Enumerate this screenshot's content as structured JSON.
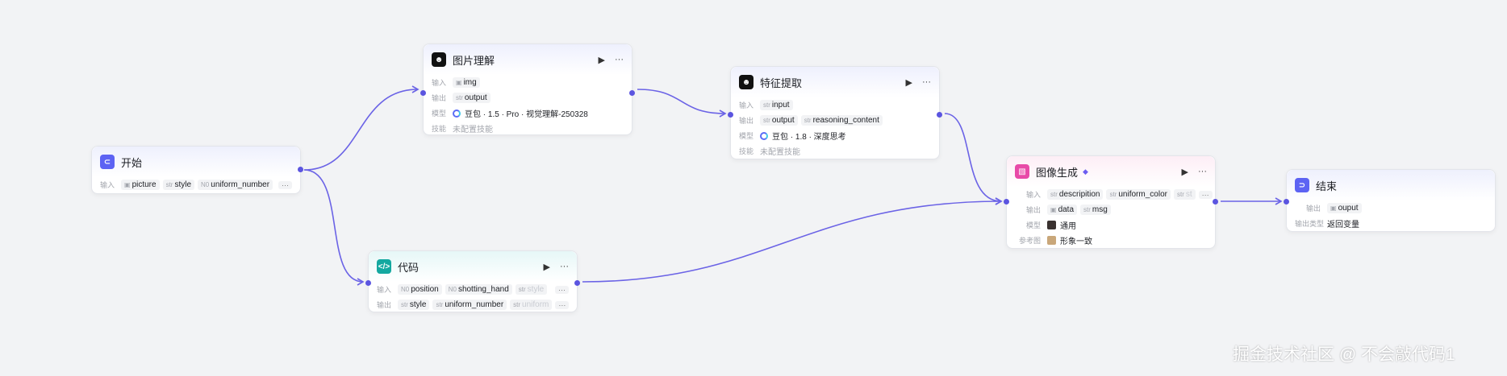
{
  "colors": {
    "edge": "#6b63e6",
    "accent": "#5b55e0"
  },
  "start": {
    "title": "开始",
    "input_label": "输入",
    "inputs": [
      {
        "type": "img",
        "name": "picture"
      },
      {
        "type": "str",
        "name": "style"
      },
      {
        "type": "N0",
        "name": "uniform_number"
      }
    ],
    "more": "···"
  },
  "image_understand": {
    "title": "图片理解",
    "input_label": "输入",
    "inputs": [
      {
        "type": "img",
        "name": "img"
      }
    ],
    "output_label": "输出",
    "outputs": [
      {
        "type": "str",
        "name": "output"
      }
    ],
    "model_label": "模型",
    "model": "豆包 · 1.5 · Pro · 视觉理解-250328",
    "skill_label": "技能",
    "skill": "未配置技能"
  },
  "feature_extract": {
    "title": "特征提取",
    "input_label": "输入",
    "inputs": [
      {
        "type": "str",
        "name": "input"
      }
    ],
    "output_label": "输出",
    "outputs": [
      {
        "type": "str",
        "name": "output"
      },
      {
        "type": "str",
        "name": "reasoning_content"
      }
    ],
    "model_label": "模型",
    "model": "豆包 · 1.8 · 深度思考",
    "skill_label": "技能",
    "skill": "未配置技能"
  },
  "code": {
    "title": "代码",
    "input_label": "输入",
    "inputs": [
      {
        "type": "N0",
        "name": "position"
      },
      {
        "type": "N0",
        "name": "shotting_hand"
      },
      {
        "type": "str",
        "name": "style"
      }
    ],
    "output_label": "输出",
    "outputs": [
      {
        "type": "str",
        "name": "style"
      },
      {
        "type": "str",
        "name": "uniform_number"
      },
      {
        "type": "str",
        "name": "uniform"
      }
    ],
    "more": "···"
  },
  "image_gen": {
    "title": "图像生成",
    "input_label": "输入",
    "inputs": [
      {
        "type": "str",
        "name": "descripition"
      },
      {
        "type": "str",
        "name": "uniform_color"
      },
      {
        "type": "str",
        "name": "st"
      }
    ],
    "output_label": "输出",
    "outputs": [
      {
        "type": "img",
        "name": "data"
      },
      {
        "type": "str",
        "name": "msg"
      }
    ],
    "model_label": "模型",
    "model": "通用",
    "ref_label": "参考图",
    "ref": "形象一致",
    "more": "···"
  },
  "end": {
    "title": "结束",
    "output_label": "输出",
    "outputs": [
      {
        "type": "img",
        "name": "ouput"
      }
    ],
    "output_type_label": "输出类型",
    "output_type": "返回变量"
  },
  "actions": {
    "run": "▶",
    "menu": "···"
  },
  "watermark": "掘金技术社区 @ 不会敲代码1"
}
